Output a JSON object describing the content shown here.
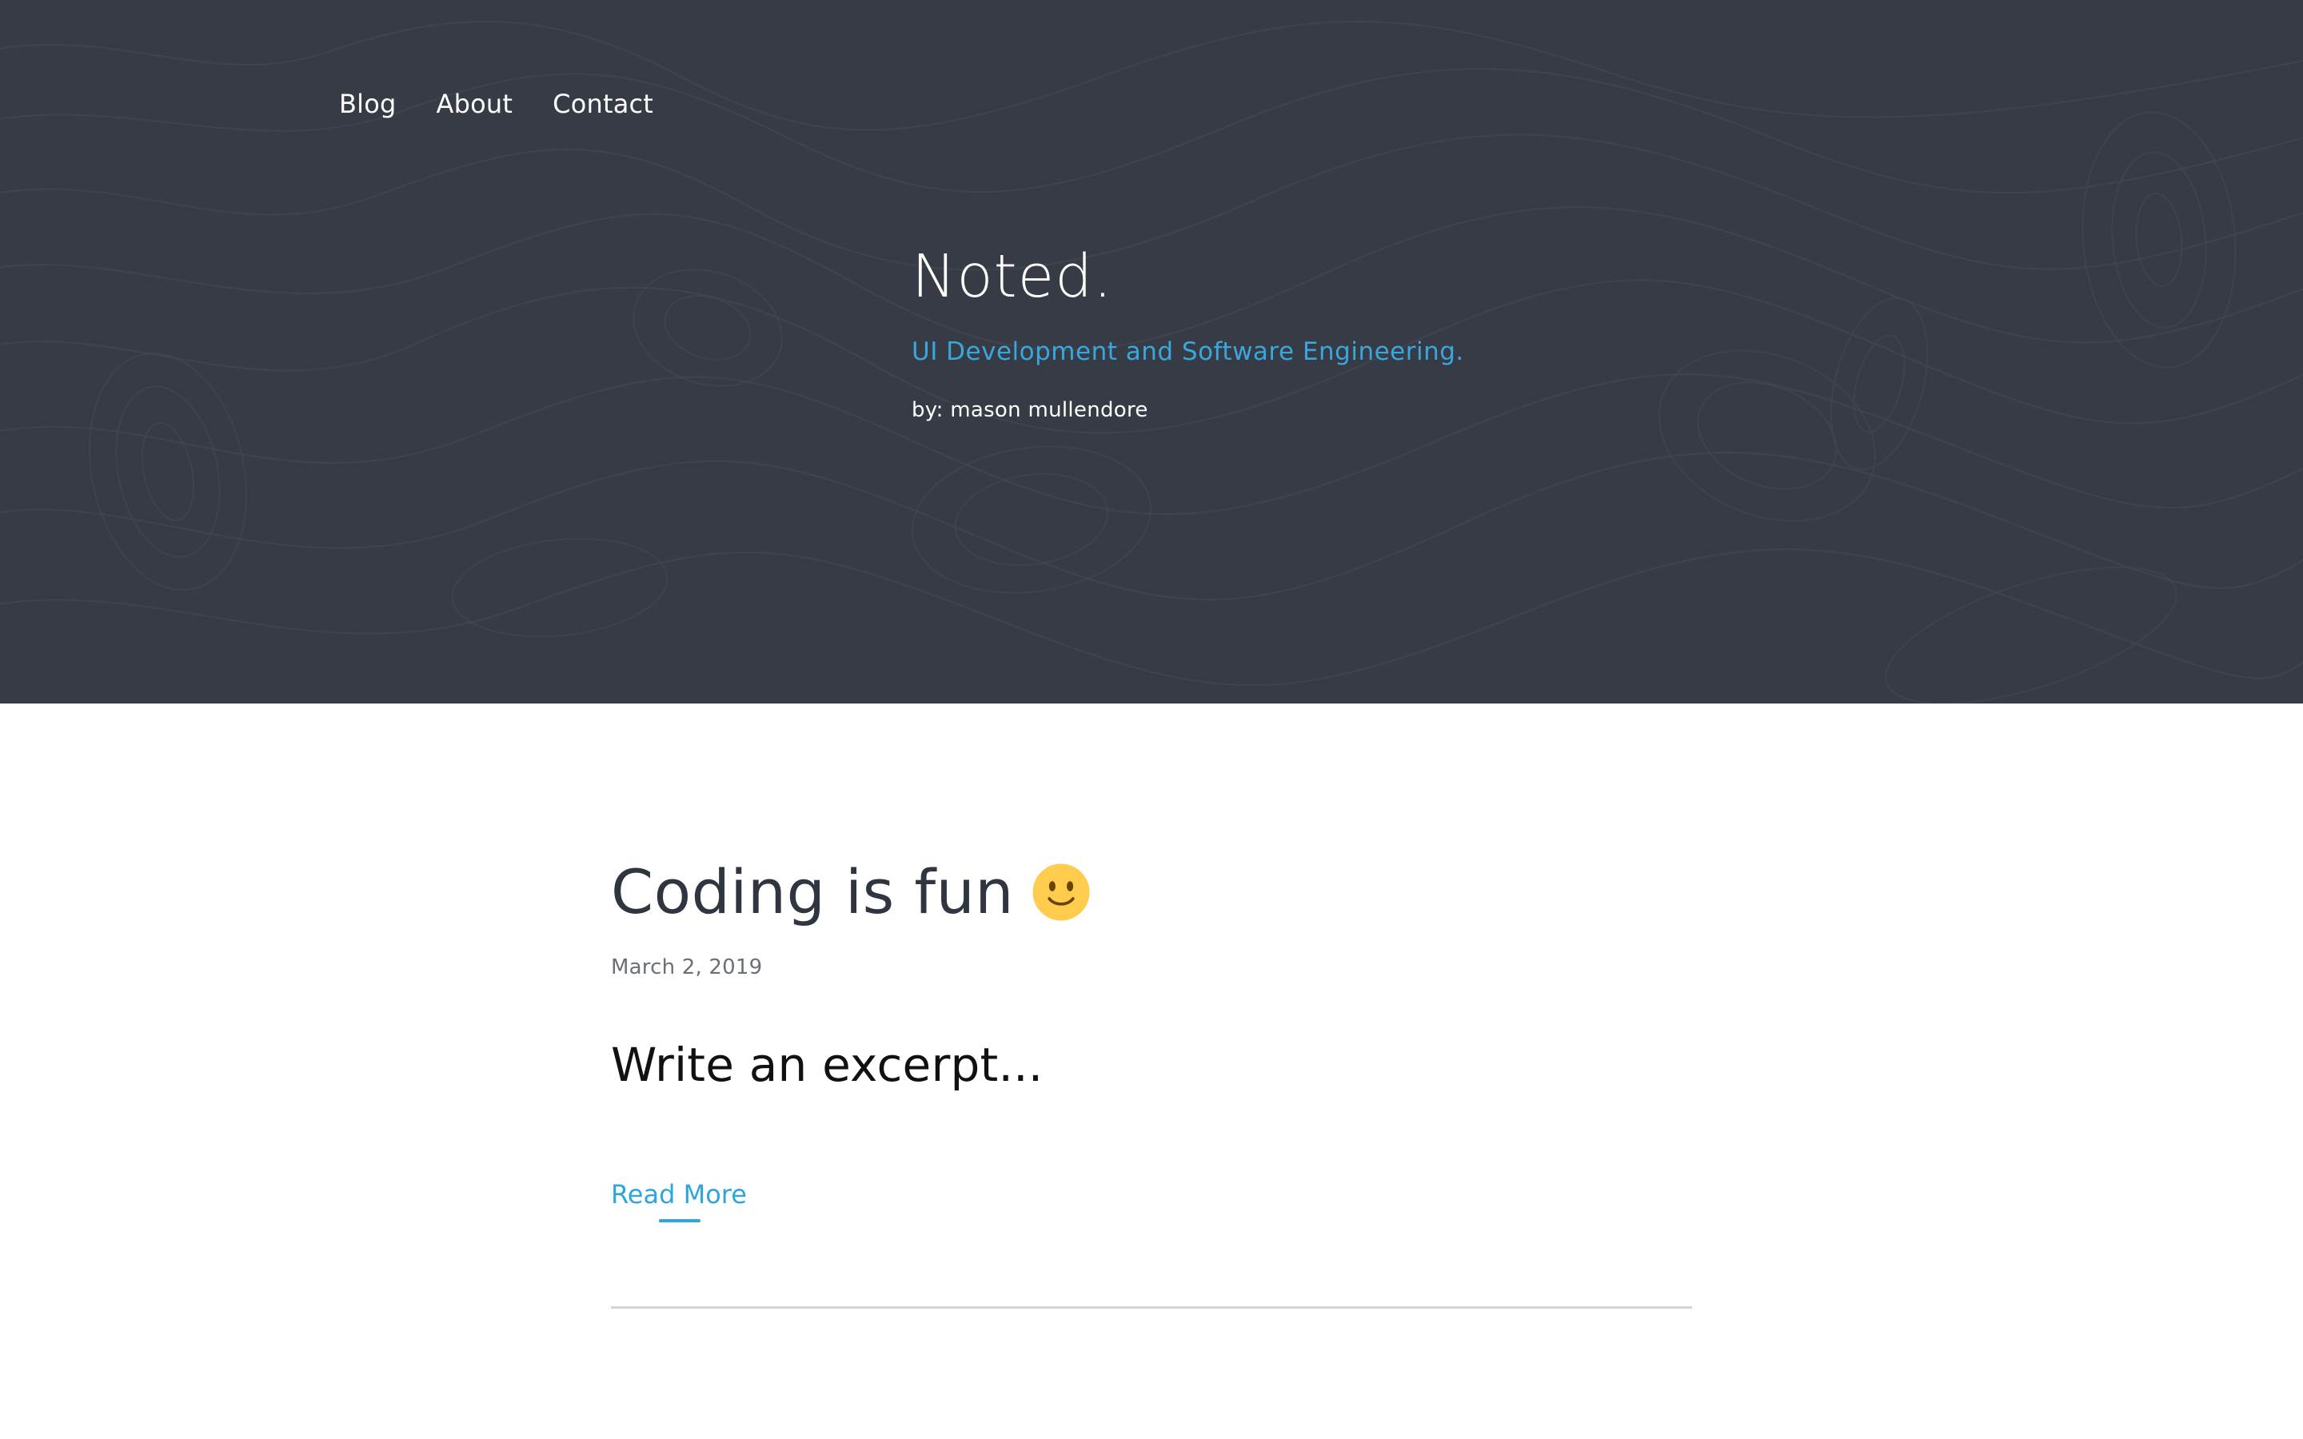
{
  "nav": {
    "items": [
      {
        "label": "Blog"
      },
      {
        "label": "About"
      },
      {
        "label": "Contact"
      }
    ]
  },
  "hero": {
    "title": "Noted.",
    "tagline": "UI Development and Software Engineering.",
    "byline": "by: mason mullendore",
    "background_color": "#363b45",
    "topography_line_color": "#4a505b"
  },
  "post": {
    "title": "Coding is fun",
    "emoji_icon": "smiling-face-icon",
    "date": "March 2, 2019",
    "excerpt": "Write an excerpt...",
    "read_more_label": "Read More"
  },
  "colors": {
    "accent": "#2ea6dc",
    "title_text": "#2f3640",
    "muted_text": "#6b7078",
    "divider": "#d4d4d4"
  }
}
